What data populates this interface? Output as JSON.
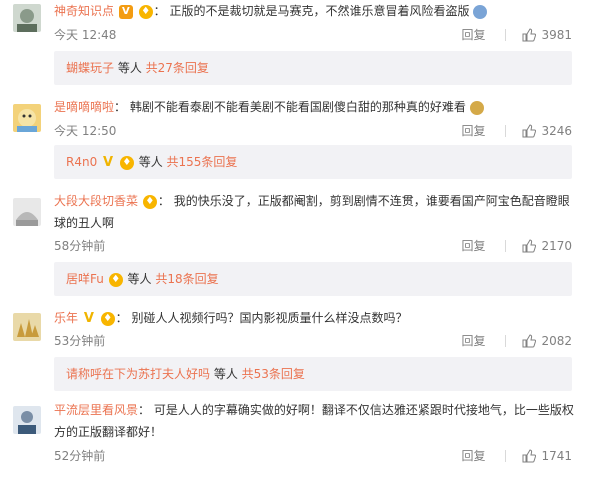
{
  "comments": [
    {
      "username": "神奇知识点",
      "sep": "：",
      "text": "正版的不是裁切就是马赛克，不然谁乐意冒着风险看盗版",
      "time": "今天 12:48",
      "reply_label": "回复",
      "likes": "3981",
      "sub": {
        "name": "蝴蝶玩子",
        "mid": " 等人 ",
        "count": "共27条回复"
      }
    },
    {
      "username": "是嘀嘀嘀啦",
      "sep": "：",
      "text": "韩剧不能看泰剧不能看美剧不能看国剧傻白甜的那种真的好难看",
      "time": "今天 12:50",
      "reply_label": "回复",
      "likes": "3246",
      "sub": {
        "name": "R4n0",
        "mid": " 等人 ",
        "count": "共155条回复"
      }
    },
    {
      "username": "大段大段切香菜",
      "sep": "：",
      "text": "我的快乐没了，正版都阉割，剪到剧情不连贯，谁要看国产阿宝色配音瞪眼球的丑人啊",
      "time": "58分钟前",
      "reply_label": "回复",
      "likes": "2170",
      "sub": {
        "name": "居咩Fu",
        "mid": " 等人 ",
        "count": "共18条回复"
      }
    },
    {
      "username": "乐年",
      "sep": "：",
      "text": "别碰人人视频行吗？国内影视质量什么样没点数吗？",
      "time": "53分钟前",
      "reply_label": "回复",
      "likes": "2082",
      "sub": {
        "name": "请称呼在下为苏打夫人好吗",
        "mid": " 等人 ",
        "count": "共53条回复"
      }
    },
    {
      "username": "平流层里看风景",
      "sep": "：",
      "text": "可是人人的字幕确实做的好啊！翻译不仅信达雅还紧跟时代接地气，比一些版权方的正版翻译都好！",
      "time": "52分钟前",
      "reply_label": "回复",
      "likes": "1741"
    }
  ]
}
